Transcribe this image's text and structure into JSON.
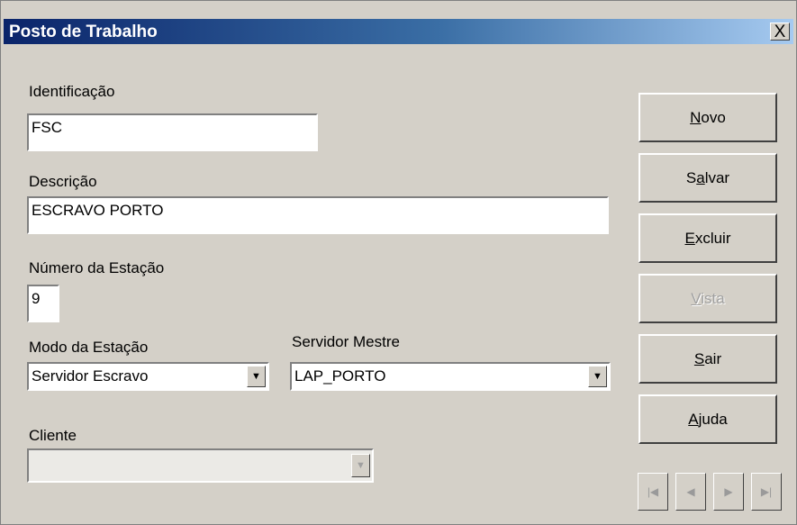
{
  "window": {
    "title": "Posto de Trabalho",
    "close_label": "X"
  },
  "form": {
    "identificacao": {
      "label": "Identificação",
      "value": "FSC"
    },
    "descricao": {
      "label": "Descrição",
      "value": "ESCRAVO PORTO"
    },
    "numero_estacao": {
      "label": "Número da Estação",
      "value": "9"
    },
    "modo_estacao": {
      "label": "Modo da Estação",
      "value": "Servidor Escravo"
    },
    "servidor_mestre": {
      "label": "Servidor Mestre",
      "value": "LAP_PORTO"
    },
    "cliente": {
      "label": "Cliente",
      "value": ""
    }
  },
  "buttons": {
    "novo": {
      "label": "Novo",
      "mnemonic": "N",
      "enabled": true
    },
    "salvar": {
      "label": "Salvar",
      "mnemonic": "a",
      "enabled": true
    },
    "excluir": {
      "label": "Excluir",
      "mnemonic": "E",
      "enabled": true
    },
    "vista": {
      "label": "Vista",
      "mnemonic": "V",
      "enabled": false
    },
    "sair": {
      "label": "Sair",
      "mnemonic": "S",
      "enabled": true
    },
    "ajuda": {
      "label": "Ajuda",
      "mnemonic": "A",
      "enabled": true
    }
  },
  "nav": {
    "first_icon": "first-record-icon",
    "prev_icon": "previous-record-icon",
    "next_icon": "next-record-icon",
    "last_icon": "last-record-icon",
    "enabled": false
  },
  "colors": {
    "title_gradient_start": "#0a246a",
    "title_gradient_end": "#a6caf0",
    "face": "#d4d0c8",
    "disabled_text": "#a0a0a0"
  }
}
